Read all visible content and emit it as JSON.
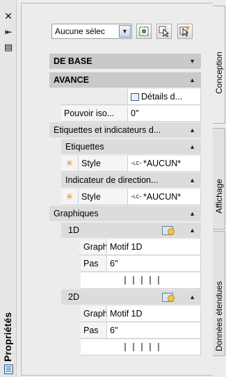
{
  "palette": {
    "title": "Propriétés",
    "close_glyph": "✕",
    "autohide_glyph": "⇤",
    "menu_glyph": "▤"
  },
  "toolbar": {
    "selector_value": "Aucune sélec",
    "dropdown_glyph": "▼",
    "buttons": [
      "quick-select-icon",
      "select-objects-icon",
      "toggle-pickadd-icon"
    ]
  },
  "tabs": [
    {
      "label": "Conception"
    },
    {
      "label": "Affichage"
    },
    {
      "label": "Données étendues"
    }
  ],
  "grid": {
    "de_base": "DE BASE",
    "avance": "AVANCE",
    "details": "Détails d...",
    "pouvoir_label": "Pouvoir iso...",
    "pouvoir_value": "0\"",
    "etiquettes_ind": "Etiquettes et indicateurs d...",
    "etiquettes": "Etiquettes",
    "style_label": "Style",
    "style_value": "*AUCUN*",
    "indicateur": "Indicateur de direction...",
    "style_label2": "Style",
    "style_value2": "*AUCUN*",
    "graphiques": "Graphiques",
    "g1d": "1D",
    "graphi_1d_label": "Graphi...",
    "graphi_1d_value": "Motif 1D",
    "pas_1d_label": "Pas",
    "pas_1d_value": "6\"",
    "g2d": "2D",
    "graphi_2d_label": "Graphi...",
    "graphi_2d_value": "Motif 1D",
    "pas_2d_label": "Pas",
    "pas_2d_value": "6\"",
    "lc_glyph": "⁃LC⁃",
    "asterisk": "✳"
  }
}
